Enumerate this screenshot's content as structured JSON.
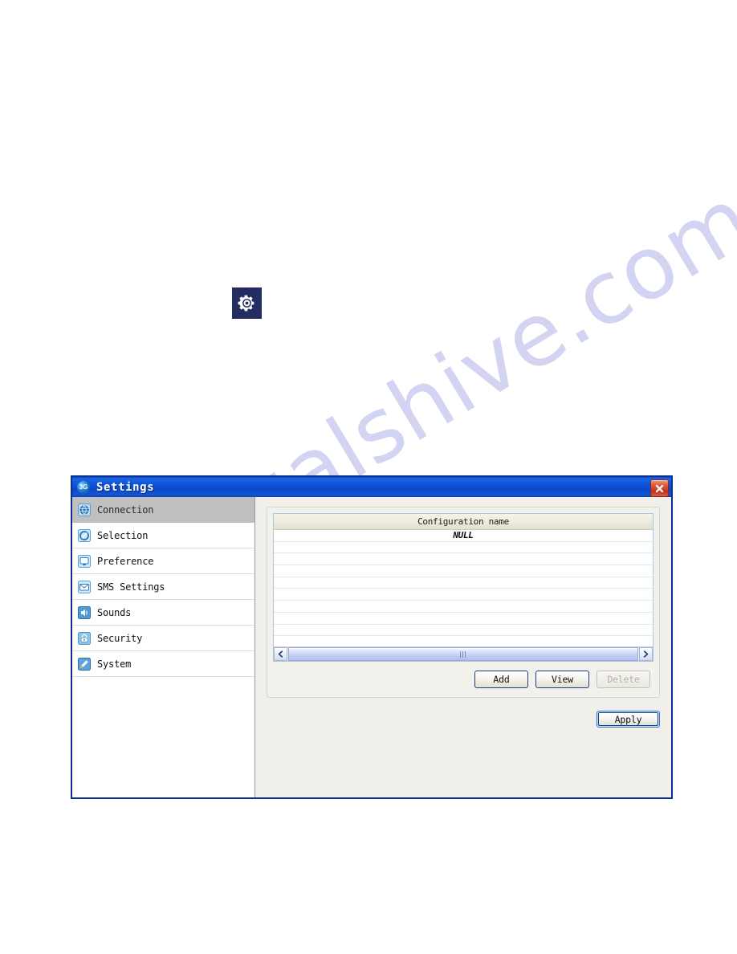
{
  "page": {
    "watermark_text": "manualshive.com",
    "gear_badge_icon": "gear-icon"
  },
  "window": {
    "title": "Settings",
    "title_icon": "3g-globe-icon",
    "close_icon": "close-icon",
    "close_label": "Close"
  },
  "sidebar": {
    "items": [
      {
        "label": "Connection",
        "icon": "globe-connection-icon",
        "selected": true
      },
      {
        "label": "Selection",
        "icon": "network-selection-icon",
        "selected": false
      },
      {
        "label": "Preference",
        "icon": "monitor-preference-icon",
        "selected": false
      },
      {
        "label": "SMS Settings",
        "icon": "envelope-sms-icon",
        "selected": false
      },
      {
        "label": "Sounds",
        "icon": "speaker-sounds-icon",
        "selected": false
      },
      {
        "label": "Security",
        "icon": "lock-security-icon",
        "selected": false
      },
      {
        "label": "System",
        "icon": "tools-system-icon",
        "selected": false
      }
    ]
  },
  "main": {
    "list": {
      "columns": [
        "Configuration name"
      ],
      "rows": [
        [
          "NULL"
        ],
        [
          ""
        ],
        [
          ""
        ],
        [
          ""
        ],
        [
          ""
        ],
        [
          ""
        ],
        [
          ""
        ],
        [
          ""
        ],
        [
          ""
        ],
        [
          ""
        ],
        [
          ""
        ]
      ],
      "hscrollbar": {
        "left_arrow_icon": "chevron-left-icon",
        "right_arrow_icon": "chevron-right-icon",
        "grip_icon": "scrollbar-grip-icon"
      }
    },
    "buttons": [
      {
        "label": "Add",
        "disabled": false
      },
      {
        "label": "View",
        "disabled": false
      },
      {
        "label": "Delete",
        "disabled": true
      }
    ],
    "apply": {
      "label": "Apply"
    }
  },
  "colors": {
    "titlebar_blue": "#0d53d8",
    "window_border": "#0a2f8f",
    "selected_sidebar": "#bfbfbf",
    "close_red": "#c4301a",
    "watermark": "#ccccf0",
    "gear_badge_bg": "#232d62",
    "apply_focus_border": "#0b3d91"
  }
}
